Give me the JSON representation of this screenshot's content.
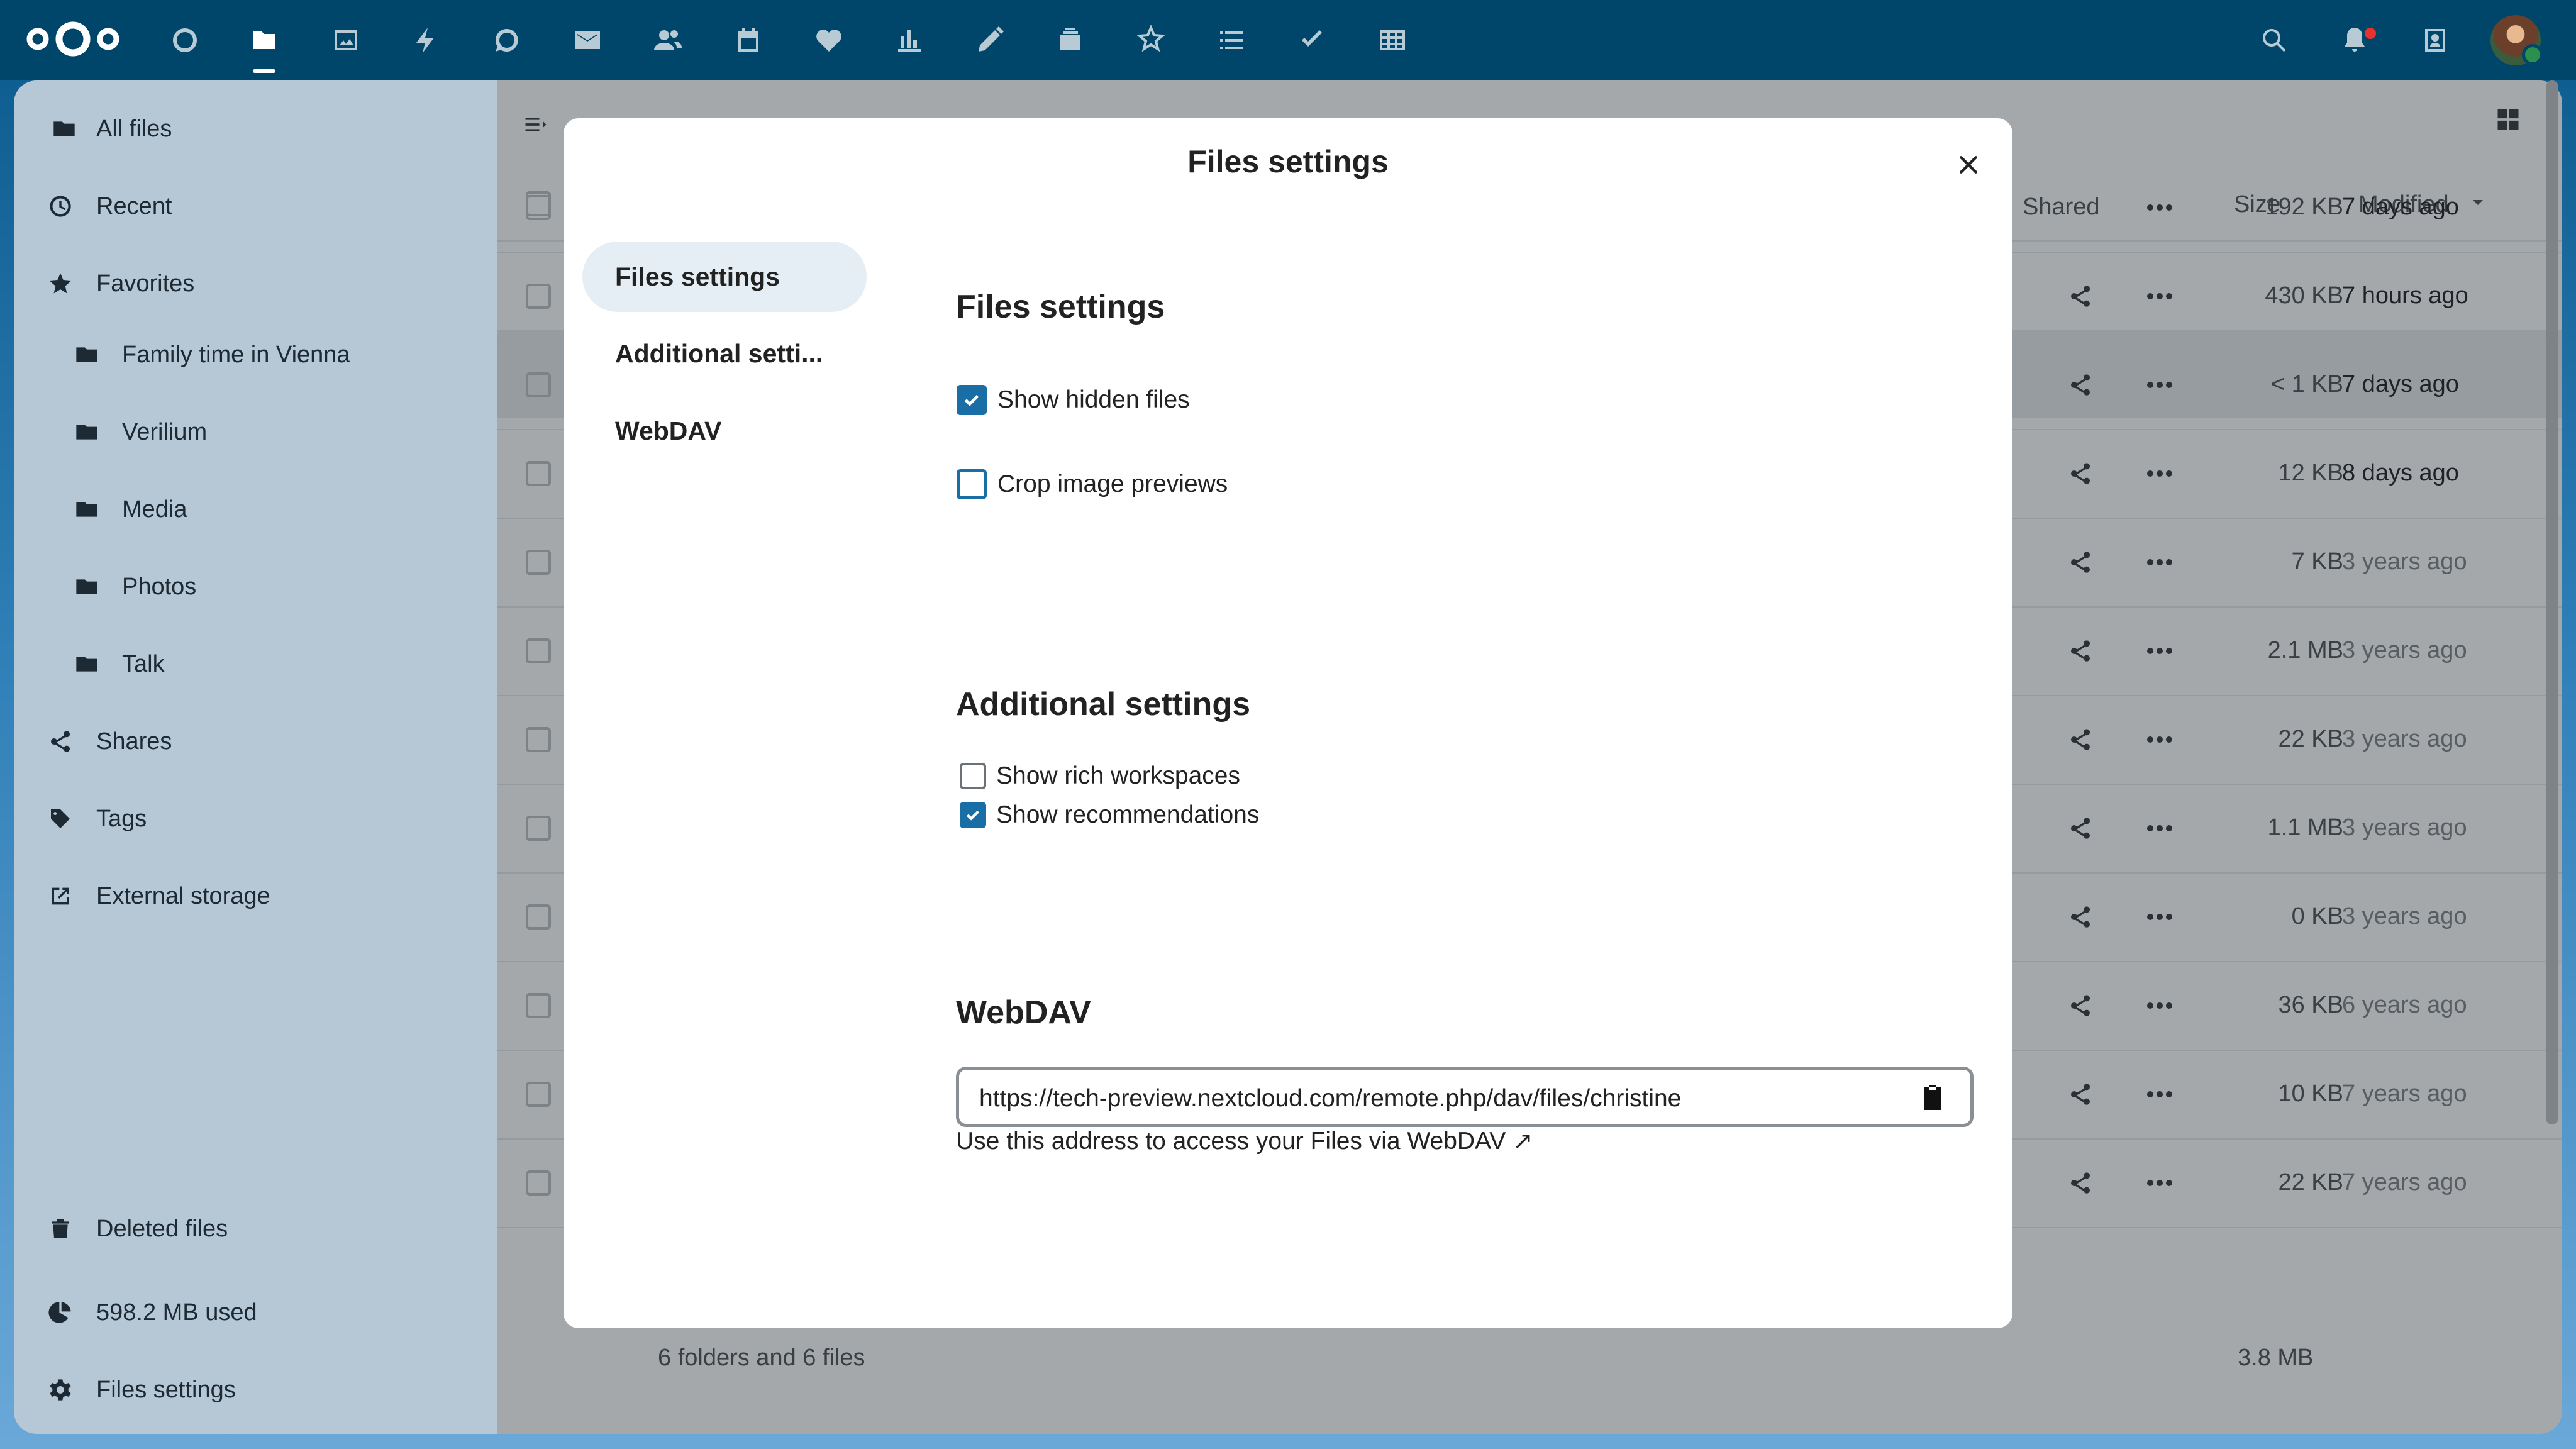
{
  "topbar": {
    "apps": [
      "dashboard",
      "files",
      "photos",
      "activity",
      "talk",
      "mail",
      "contacts",
      "calendar",
      "favorites",
      "analytics",
      "notes",
      "deck",
      "tasks-circle",
      "list",
      "checkmark",
      "tables"
    ],
    "accent": "#00466b"
  },
  "sidebar": {
    "items": [
      {
        "label": "All files",
        "icon": "folder-icon"
      },
      {
        "label": "Recent",
        "icon": "clock-icon"
      },
      {
        "label": "Favorites",
        "icon": "star-icon"
      },
      {
        "label": "Family time in Vienna",
        "icon": "folder-icon"
      },
      {
        "label": "Verilium",
        "icon": "folder-icon"
      },
      {
        "label": "Media",
        "icon": "folder-icon"
      },
      {
        "label": "Photos",
        "icon": "folder-icon"
      },
      {
        "label": "Talk",
        "icon": "folder-icon"
      },
      {
        "label": "Shares",
        "icon": "share-icon"
      },
      {
        "label": "Tags",
        "icon": "tag-icon"
      },
      {
        "label": "External storage",
        "icon": "external-icon"
      }
    ],
    "deleted": "Deleted files",
    "quota": "598.2 MB used",
    "settings": "Files settings"
  },
  "filelist": {
    "col_size": "Size",
    "col_modified": "Modified",
    "rows": [
      {
        "status": "Shared",
        "size": "192 KB",
        "modified": "7 days ago"
      },
      {
        "status": "",
        "size": "430 KB",
        "modified": "7 hours ago"
      },
      {
        "status": "",
        "size": "< 1 KB",
        "modified": "7 days ago"
      },
      {
        "status": "",
        "size": "12 KB",
        "modified": "8 days ago"
      },
      {
        "status": "",
        "size": "7 KB",
        "modified": "3 years ago"
      },
      {
        "status": "",
        "size": "2.1 MB",
        "modified": "3 years ago"
      },
      {
        "status": "",
        "size": "22 KB",
        "modified": "3 years ago"
      },
      {
        "status": "",
        "size": "1.1 MB",
        "modified": "3 years ago"
      },
      {
        "status": "",
        "size": "0 KB",
        "modified": "3 years ago"
      },
      {
        "status": "",
        "size": "36 KB",
        "modified": "6 years ago"
      },
      {
        "status": "",
        "size": "10 KB",
        "modified": "7 years ago"
      },
      {
        "status": "",
        "size": "22 KB",
        "modified": "7 years ago"
      }
    ],
    "summary": "6 folders and 6 files",
    "total_size": "3.8 MB"
  },
  "modal": {
    "title": "Files settings",
    "nav": [
      "Files settings",
      "Additional setti...",
      "WebDAV"
    ],
    "files_settings": {
      "heading": "Files settings",
      "show_hidden": {
        "label": "Show hidden files",
        "checked": true
      },
      "crop_previews": {
        "label": "Crop image previews",
        "checked": false
      }
    },
    "additional": {
      "heading": "Additional settings",
      "rich_workspaces": {
        "label": "Show rich workspaces",
        "checked": false
      },
      "recommendations": {
        "label": "Show recommendations",
        "checked": true
      }
    },
    "webdav": {
      "heading": "WebDAV",
      "url": "https://tech-preview.nextcloud.com/remote.php/dav/files/christine",
      "hint": "Use this address to access your Files via WebDAV ↗"
    }
  }
}
